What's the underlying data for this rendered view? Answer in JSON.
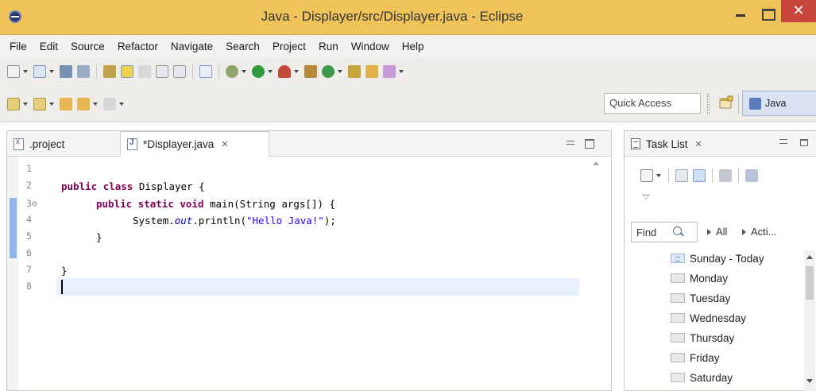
{
  "window": {
    "title": "Java - Displayer/src/Displayer.java - Eclipse",
    "close_glyph": "✕"
  },
  "menu": [
    "File",
    "Edit",
    "Source",
    "Refactor",
    "Navigate",
    "Search",
    "Project",
    "Run",
    "Window",
    "Help"
  ],
  "toolbar": {
    "quick_access_placeholder": "Quick Access",
    "perspective_label": "Java"
  },
  "editor": {
    "tabs": [
      {
        "label": ".project",
        "icon": "xml-file-icon"
      },
      {
        "label": "*Displayer.java",
        "icon": "java-file-icon",
        "close_glyph": "✕"
      }
    ],
    "line_numbers": [
      "1",
      "2",
      "3⊖",
      "4",
      "5",
      "6",
      "7",
      "8"
    ],
    "code": {
      "line2_kw1": "public",
      "line2_kw2": "class",
      "line2_rest": " Displayer {",
      "line3_kw1": "public",
      "line3_kw2": "static",
      "line3_kw3": "void",
      "line3_rest": " main(String args[]) {",
      "line4_pre": "System.",
      "line4_field": "out",
      "line4_mid": ".println(",
      "line4_str": "\"Hello Java!\"",
      "line4_end": ");",
      "line5": "}",
      "line7": "}"
    }
  },
  "task_list": {
    "tab_label": "Task List",
    "close_glyph": "✕",
    "find_placeholder": "Find",
    "filter_all": "All",
    "filter_activate": "Acti...",
    "categories": [
      "Sunday - Today",
      "Monday",
      "Tuesday",
      "Wednesday",
      "Thursday",
      "Friday",
      "Saturday"
    ]
  },
  "colors": {
    "titlebar": "#efc35a",
    "close_button": "#c7443a",
    "keyword": "#7f0055",
    "string": "#2a00ff",
    "field": "#0000c0",
    "current_line": "#e8f2fe"
  }
}
